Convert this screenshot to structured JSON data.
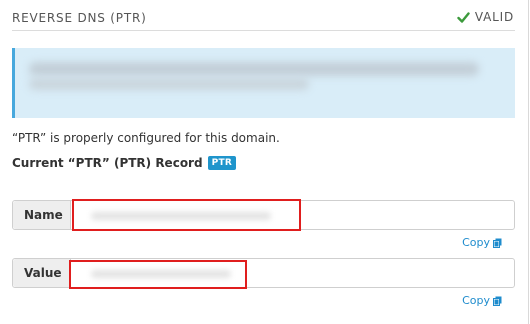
{
  "header": {
    "title": "REVERSE DNS (PTR)",
    "status_label": "VALID",
    "status_icon": "checkmark-icon",
    "status_color": "#3c9a3c"
  },
  "info_box": {
    "accent_color": "#47a8dd",
    "background_color": "#d9edf8"
  },
  "message": "“PTR” is properly configured for this domain.",
  "record": {
    "label": "Current “PTR” (PTR) Record",
    "badge": "PTR",
    "badge_color": "#1f95cc"
  },
  "fields": {
    "name": {
      "label": "Name",
      "value": "",
      "copy_label": "Copy",
      "copy_icon": "copy-icon"
    },
    "value": {
      "label": "Value",
      "value": "",
      "copy_label": "Copy",
      "copy_icon": "copy-icon"
    }
  },
  "redaction_color": "#e01e1e",
  "link_color": "#1f8ccd"
}
